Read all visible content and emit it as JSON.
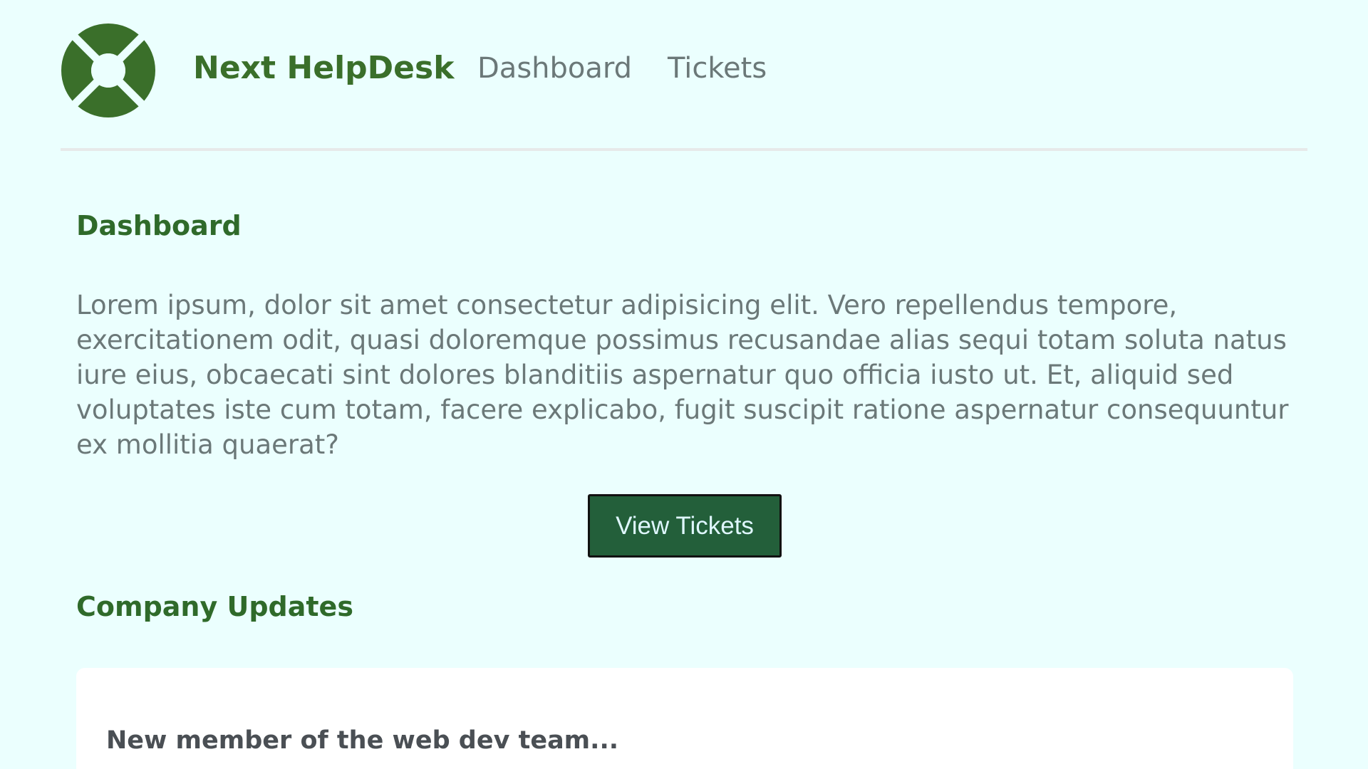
{
  "header": {
    "logo_icon": "lifebuoy-icon",
    "brand": "Next HelpDesk",
    "nav": [
      {
        "label": "Dashboard"
      },
      {
        "label": "Tickets"
      }
    ]
  },
  "main": {
    "title": "Dashboard",
    "intro": "Lorem ipsum, dolor sit amet consectetur adipisicing elit. Vero repellendus tempore, exercitationem odit, quasi doloremque possimus recusandae alias sequi totam soluta natus iure eius, obcaecati sint dolores blanditiis aspernatur quo officia iusto ut. Et, aliquid sed voluptates iste cum totam, facere explicabo, fugit suscipit ratione aspernatur consequuntur ex mollitia quaerat?",
    "view_tickets_label": "View Tickets",
    "updates_title": "Company Updates",
    "updates": [
      {
        "title": "New member of the web dev team..."
      }
    ]
  },
  "colors": {
    "brand_green": "#3a6f2a",
    "button_green": "#235f3a",
    "background": "#ebfffe"
  }
}
